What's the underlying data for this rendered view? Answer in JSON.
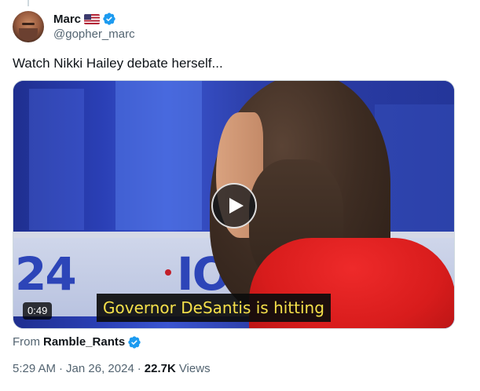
{
  "author": {
    "display_name": "Marc",
    "flag_icon": "us-flag-icon",
    "verified_icon": "verified-badge-icon",
    "handle": "@gopher_marc"
  },
  "tweet": {
    "text": "Watch Nikki Hailey debate herself..."
  },
  "media": {
    "type": "video",
    "play_icon": "play-icon",
    "duration": "0:49",
    "caption": "Governor DeSantis is hitting",
    "background_text_left": "24",
    "background_text_right": "IO"
  },
  "source": {
    "label": "From",
    "name": "Ramble_Rants",
    "verified_icon": "verified-badge-icon"
  },
  "meta": {
    "time": "5:29 AM",
    "separator": "·",
    "date": "Jan 26, 2024",
    "views_count": "22.7K",
    "views_label": "Views"
  },
  "colors": {
    "text_primary": "#0f1419",
    "text_secondary": "#536471",
    "verified_blue": "#1d9bf0",
    "caption_yellow": "#f5e04a"
  }
}
